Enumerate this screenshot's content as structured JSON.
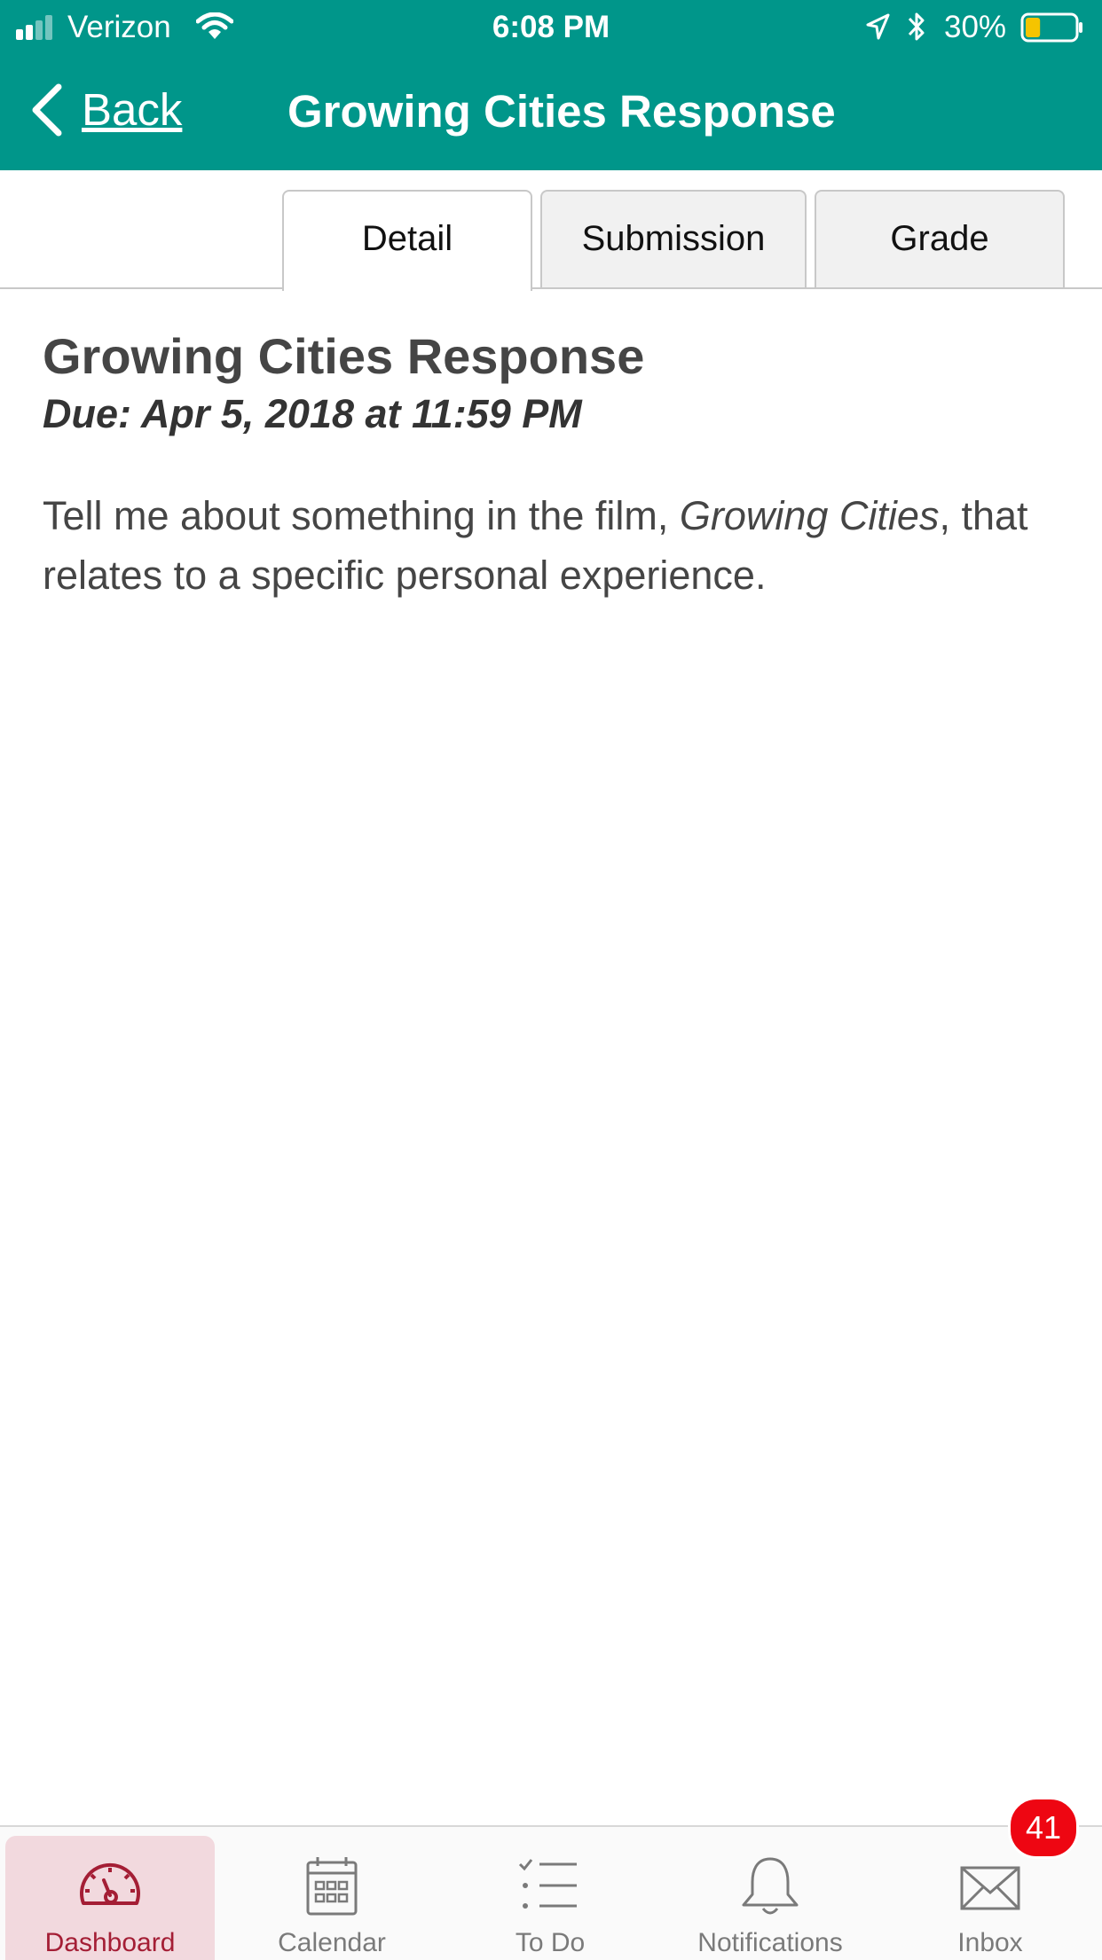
{
  "status_bar": {
    "carrier": "Verizon",
    "time": "6:08 PM",
    "battery_percent": "30%",
    "battery_level": 0.3,
    "battery_color": "#f5c400",
    "icons": [
      "signal-icon",
      "wifi-icon",
      "location-arrow-icon",
      "bluetooth-icon",
      "battery-icon"
    ]
  },
  "nav": {
    "back_label": "Back",
    "title": "Growing Cities Response",
    "background_color": "#00968a"
  },
  "tabs": [
    {
      "label": "Detail",
      "active": true
    },
    {
      "label": "Submission",
      "active": false
    },
    {
      "label": "Grade",
      "active": false
    }
  ],
  "assignment": {
    "title": "Growing Cities Response",
    "due": "Due: Apr 5, 2018 at 11:59 PM",
    "description_part1": "Tell me about something in the film, ",
    "description_emphasis": "Growing Cities",
    "description_part2": ", that relates to a specific personal experience."
  },
  "tab_bar": {
    "items": [
      {
        "label": "Dashboard",
        "icon": "dashboard-gauge-icon",
        "selected": true
      },
      {
        "label": "Calendar",
        "icon": "calendar-icon",
        "selected": false
      },
      {
        "label": "To Do",
        "icon": "todo-list-icon",
        "selected": false
      },
      {
        "label": "Notifications",
        "icon": "bell-icon",
        "selected": false
      },
      {
        "label": "Inbox",
        "icon": "envelope-icon",
        "selected": false
      }
    ],
    "inbox_badge": "41",
    "accent_color": "#a41e35"
  }
}
